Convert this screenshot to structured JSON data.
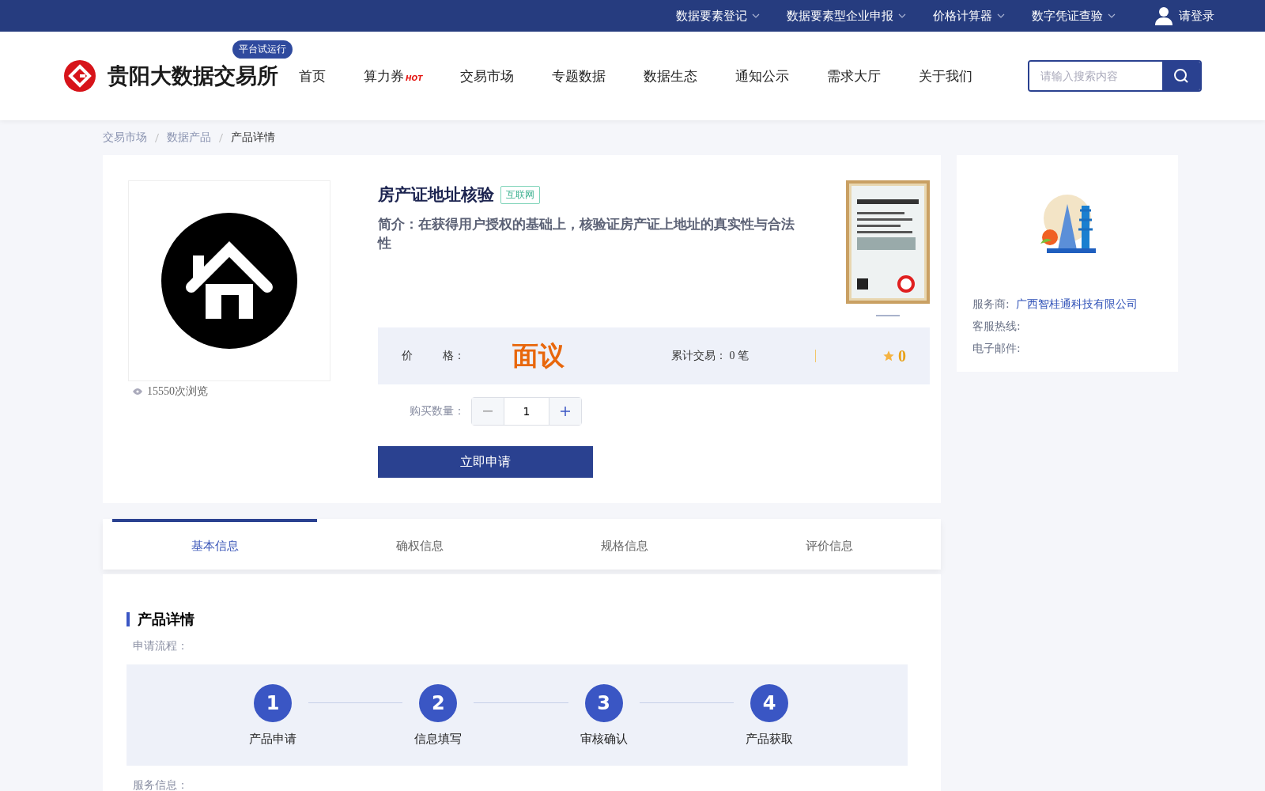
{
  "top_bar": {
    "items": [
      {
        "label": "数据要素登记",
        "dropdown": true
      },
      {
        "label": "数据要素型企业申报",
        "dropdown": true
      },
      {
        "label": "价格计算器",
        "dropdown": true
      },
      {
        "label": "数字凭证查验",
        "dropdown": true
      }
    ],
    "login": "请登录"
  },
  "header": {
    "logo_text": "贵阳大数据交易所",
    "badge": "平台试运行",
    "nav": [
      {
        "label": "首页",
        "selected": false
      },
      {
        "label": "算力券",
        "selected": false,
        "hot_badge": "HOT"
      },
      {
        "label": "交易市场",
        "selected": false
      },
      {
        "label": "专题数据",
        "selected": false
      },
      {
        "label": "数据生态",
        "selected": false
      },
      {
        "label": "通知公示",
        "selected": false
      },
      {
        "label": "需求大厅",
        "selected": false
      },
      {
        "label": "关于我们",
        "selected": false
      }
    ],
    "search": {
      "placeholder": "请输入搜索内容"
    }
  },
  "breadcrumb": [
    "交易市场",
    "数据产品",
    "产品详情"
  ],
  "product": {
    "title": "房产证地址核验",
    "tag": "互联网",
    "intro": "简介：在获得用户授权的基础上，核验证房产证上地址的真实性与合法性",
    "views": "15550次浏览",
    "price_label_1": "价",
    "price_label_2": "格：",
    "price": "面议",
    "trades": "累计交易：  0 笔",
    "rating": "0",
    "quantity_label": "购买数量：",
    "quantity": "1",
    "apply": "立即申请"
  },
  "provider": {
    "rows": [
      {
        "label": "服务商:",
        "value": "广西智桂通科技有限公司"
      },
      {
        "label": "客服热线:"
      },
      {
        "label": "电子邮件:"
      }
    ]
  },
  "tabs": [
    {
      "label": "基本信息",
      "selected": true
    },
    {
      "label": "确权信息",
      "selected": false
    },
    {
      "label": "规格信息",
      "selected": false
    },
    {
      "label": "评价信息",
      "selected": false
    }
  ],
  "detail": {
    "title": "产品详情",
    "flow_label": "申请流程：",
    "steps": [
      {
        "number": "1",
        "label": "产品申请"
      },
      {
        "number": "2",
        "label": "信息填写"
      },
      {
        "number": "3",
        "label": "审核确认"
      },
      {
        "number": "4",
        "label": "产品获取"
      }
    ],
    "next_label": "服务信息："
  }
}
